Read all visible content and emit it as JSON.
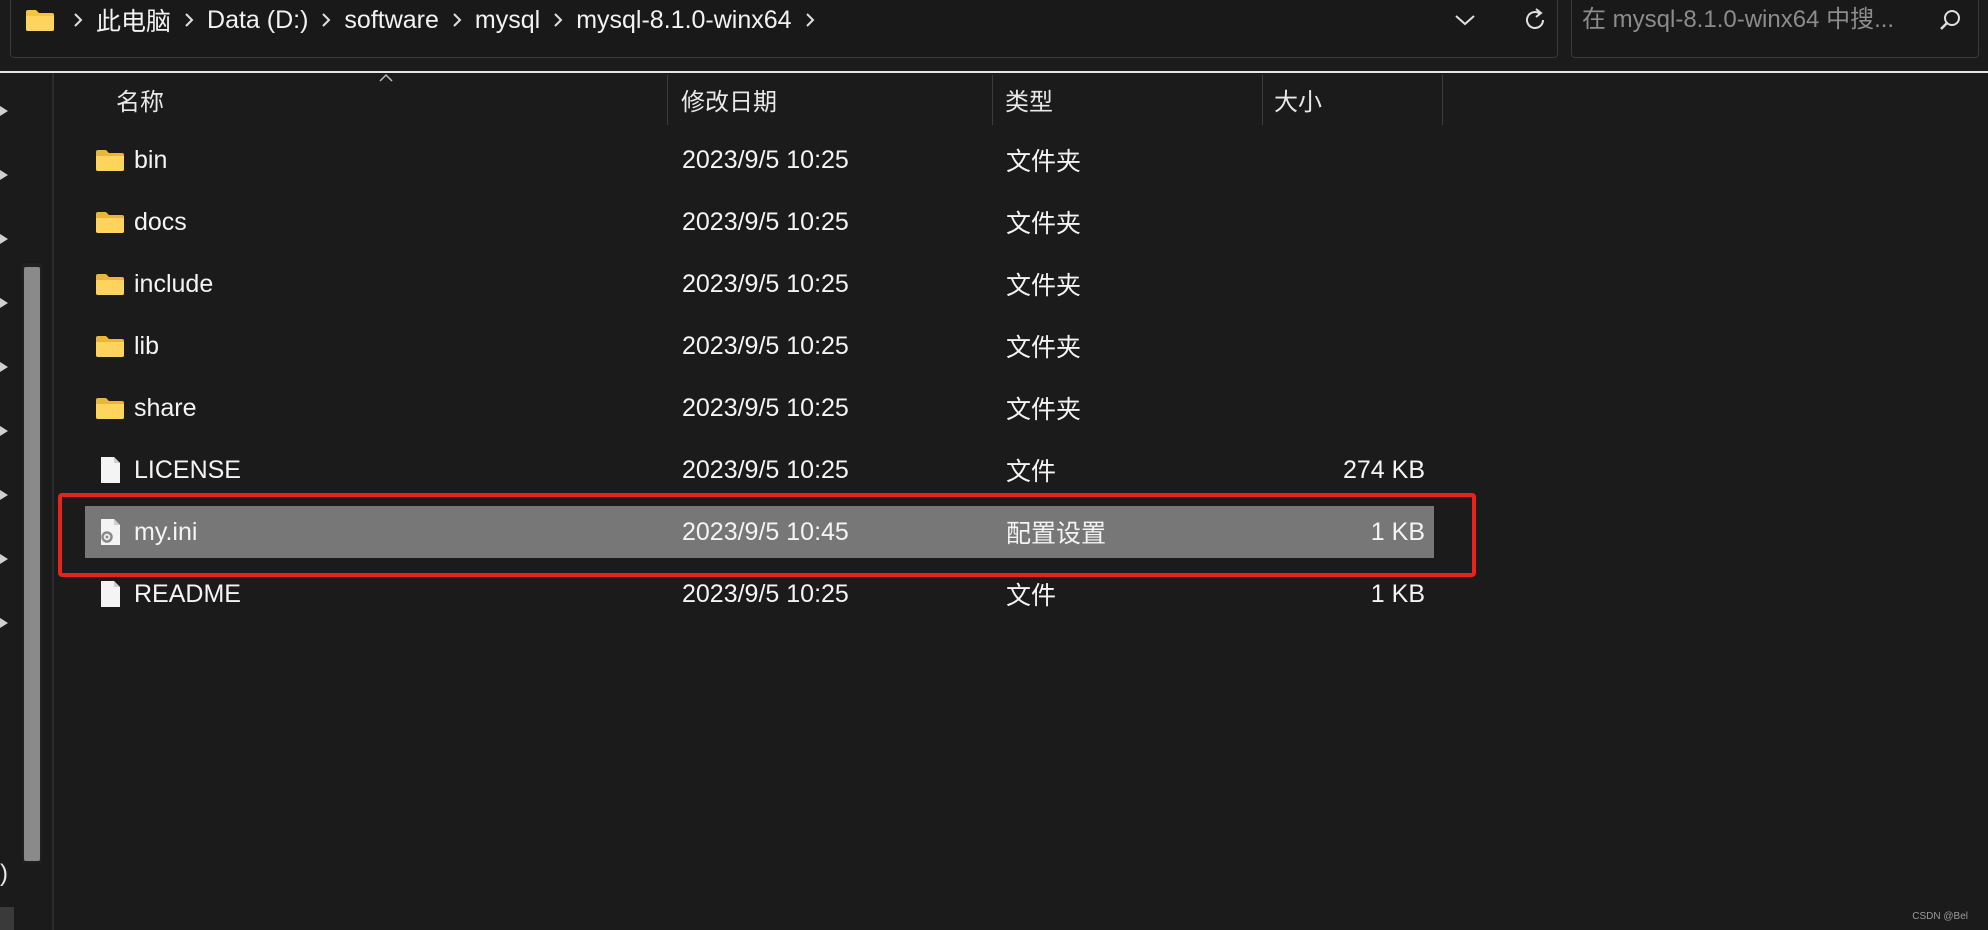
{
  "address_bar": {
    "breadcrumbs": [
      "此电脑",
      "Data (D:)",
      "software",
      "mysql",
      "mysql-8.1.0-winx64"
    ]
  },
  "search": {
    "placeholder": "在 mysql-8.1.0-winx64 中搜..."
  },
  "nav_pane": {
    "partial_text": ")"
  },
  "columns": {
    "name": "名称",
    "modified": "修改日期",
    "type": "类型",
    "size": "大小"
  },
  "files": [
    {
      "name": "bin",
      "modified": "2023/9/5 10:25",
      "type": "文件夹",
      "size": "",
      "icon": "folder-icon",
      "selected": false
    },
    {
      "name": "docs",
      "modified": "2023/9/5 10:25",
      "type": "文件夹",
      "size": "",
      "icon": "folder-icon",
      "selected": false
    },
    {
      "name": "include",
      "modified": "2023/9/5 10:25",
      "type": "文件夹",
      "size": "",
      "icon": "folder-icon",
      "selected": false
    },
    {
      "name": "lib",
      "modified": "2023/9/5 10:25",
      "type": "文件夹",
      "size": "",
      "icon": "folder-icon",
      "selected": false
    },
    {
      "name": "share",
      "modified": "2023/9/5 10:25",
      "type": "文件夹",
      "size": "",
      "icon": "folder-icon",
      "selected": false
    },
    {
      "name": "LICENSE",
      "modified": "2023/9/5 10:25",
      "type": "文件",
      "size": "274 KB",
      "icon": "file-icon",
      "selected": false
    },
    {
      "name": "my.ini",
      "modified": "2023/9/5 10:45",
      "type": "配置设置",
      "size": "1 KB",
      "icon": "config-file-icon",
      "selected": true
    },
    {
      "name": "README",
      "modified": "2023/9/5 10:25",
      "type": "文件",
      "size": "1 KB",
      "icon": "file-icon",
      "selected": false
    }
  ],
  "annotation": {
    "highlight_color": "#e8231c"
  },
  "watermark": "CSDN @Bel",
  "colors": {
    "background": "#1b1b1b",
    "selected_row": "#777777",
    "folder_yellow": "#f5c342",
    "text": "#f4f4f4"
  }
}
